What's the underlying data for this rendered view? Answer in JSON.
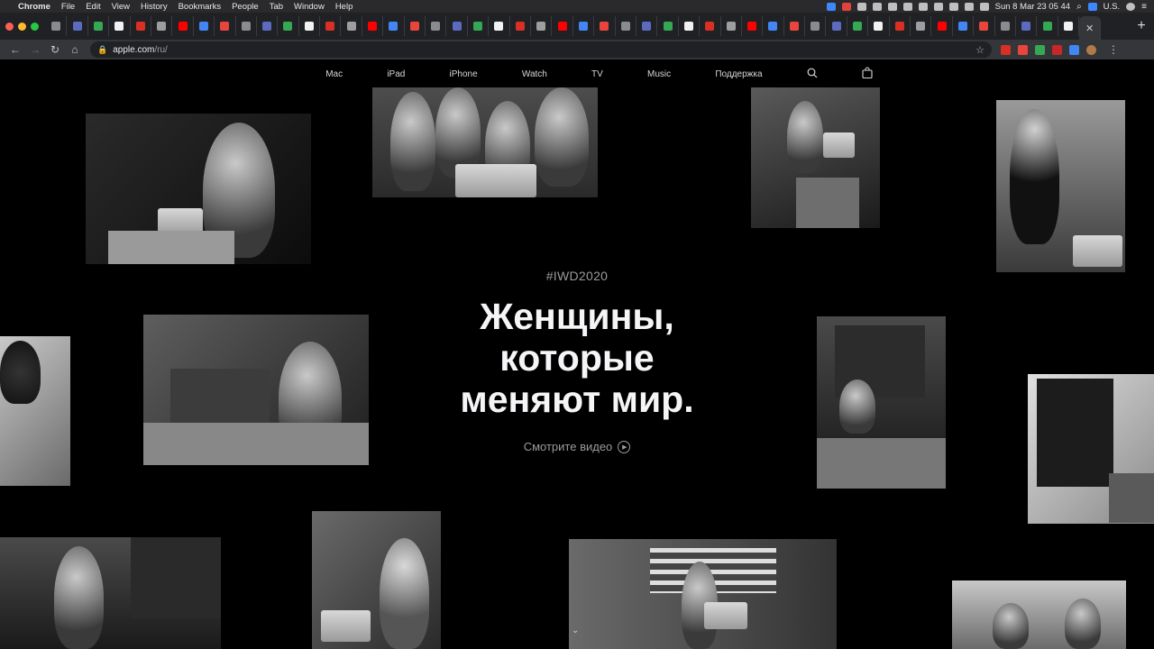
{
  "menubar": {
    "app_name": "Chrome",
    "menus": [
      "File",
      "Edit",
      "View",
      "History",
      "Bookmarks",
      "People",
      "Tab",
      "Window",
      "Help"
    ],
    "clock": "Sun 8 Mar  23 05 44",
    "input_source": "U.S."
  },
  "browser": {
    "url_host": "apple.com",
    "url_path": "/ru/",
    "tab_count": 50,
    "traffic_lights": [
      "#ff5f57",
      "#febc2e",
      "#28c840"
    ]
  },
  "nav": {
    "items": [
      "Mac",
      "iPad",
      "iPhone",
      "Watch",
      "TV",
      "Music",
      "Поддержка"
    ]
  },
  "hero": {
    "tag": "#IWD2020",
    "headline_lines": [
      "Женщины,",
      "которые",
      "меняют мир."
    ],
    "cta": "Смотрите видео"
  },
  "icons": {
    "apple": "apple-logo-icon",
    "search": "search-icon",
    "bag": "shopping-bag-icon",
    "play": "play-circle-icon",
    "scroll": "chevron-down-icon"
  }
}
